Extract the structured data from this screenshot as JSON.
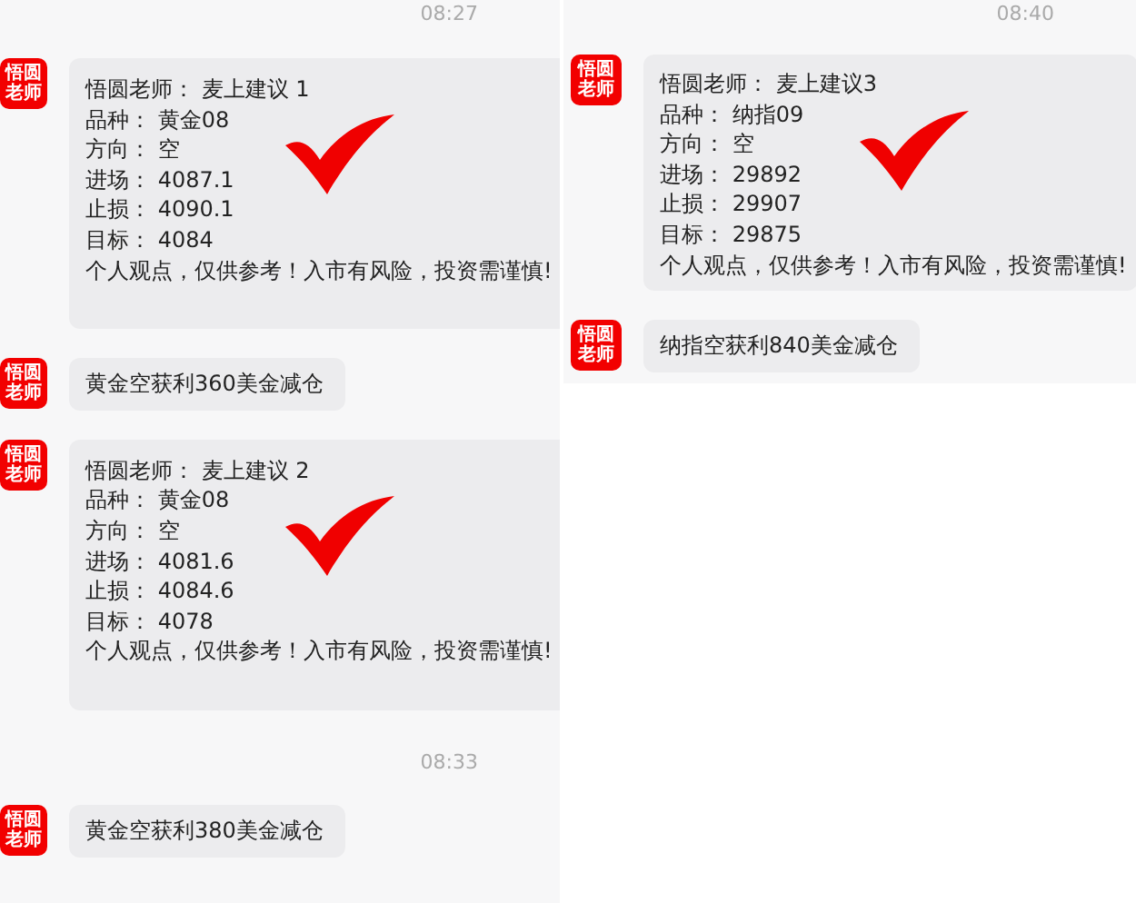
{
  "panels": [
    {
      "items": [
        {
          "kind": "time",
          "text": "08:27"
        },
        {
          "kind": "message",
          "avatar": [
            "悟圆",
            "老师"
          ],
          "lines": [
            "悟圆老师：  麦上建议 1",
            "品种：  黄金08",
            "方向：  空",
            "进场：  4087.1",
            "止损：  4090.1",
            "目标：  4084",
            "个人观点，仅供参考！入市有风险，投资需谨慎!"
          ],
          "checked": true
        },
        {
          "kind": "message",
          "avatar": [
            "悟圆",
            "老师"
          ],
          "lines": [
            "黄金空获利360美金减仓"
          ]
        },
        {
          "kind": "message",
          "avatar": [
            "悟圆",
            "老师"
          ],
          "lines": [
            "悟圆老师：  麦上建议 2",
            "品种：  黄金08",
            "方向：  空",
            "进场：  4081.6",
            "止损：  4084.6",
            "目标：  4078",
            "个人观点，仅供参考！入市有风险，投资需谨慎!"
          ],
          "checked": true
        },
        {
          "kind": "time",
          "text": "08:33"
        },
        {
          "kind": "message",
          "avatar": [
            "悟圆",
            "老师"
          ],
          "lines": [
            "黄金空获利380美金减仓"
          ]
        }
      ]
    },
    {
      "items": [
        {
          "kind": "time",
          "text": "08:40"
        },
        {
          "kind": "message",
          "avatar": [
            "悟圆",
            "老师"
          ],
          "lines": [
            "悟圆老师：  麦上建议3",
            "品种：  纳指09",
            "方向：  空",
            "进场：  29892",
            "止损：  29907",
            "目标：  29875",
            "个人观点，仅供参考！入市有风险，投资需谨慎!"
          ],
          "checked": true
        },
        {
          "kind": "message",
          "avatar": [
            "悟圆",
            "老师"
          ],
          "lines": [
            "纳指空获利840美金减仓"
          ]
        }
      ]
    }
  ]
}
